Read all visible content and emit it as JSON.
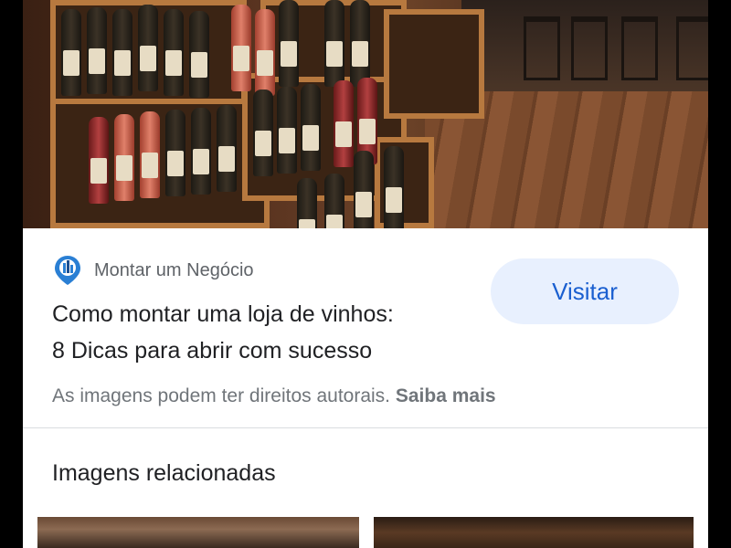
{
  "result": {
    "image_alt": "Interior of a wine shop with wooden crates of bottles",
    "source_name": "Montar um Negócio",
    "source_icon": "location-pin-logo-icon",
    "title_line1": "Como montar uma loja de vinhos:",
    "title_line2": "8 Dicas para abrir com sucesso",
    "visit_label": "Visitar",
    "copyright_text": "As imagens podem ter direitos autorais.",
    "learn_more_label": "Saiba mais"
  },
  "related": {
    "title": "Imagens relacionadas"
  },
  "colors": {
    "visit_bg": "#e8f0fe",
    "visit_text": "#1a5fd0",
    "muted_text": "#70757a"
  }
}
